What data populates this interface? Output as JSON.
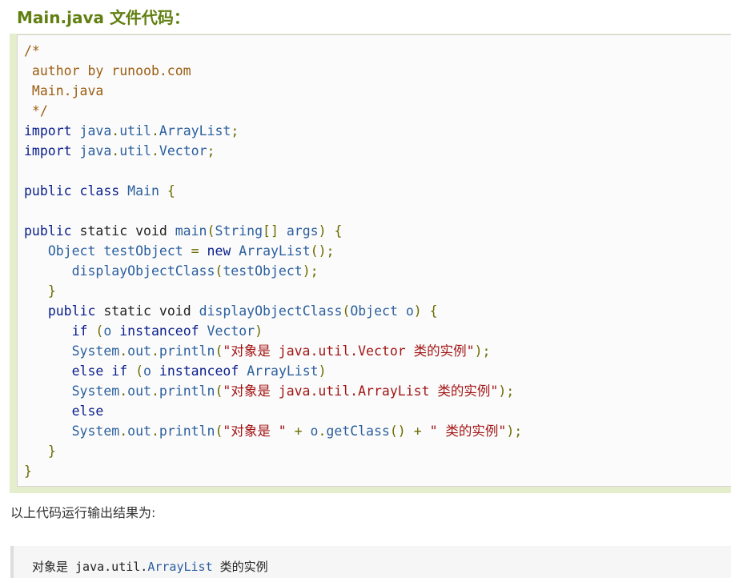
{
  "heading": "Main.java 文件代码：",
  "code_lines": [
    [
      {
        "c": "c",
        "t": "/*"
      }
    ],
    [
      {
        "c": "c",
        "t": " author by runoob.com"
      }
    ],
    [
      {
        "c": "c",
        "t": " Main.java"
      }
    ],
    [
      {
        "c": "c",
        "t": " */"
      }
    ],
    [
      {
        "c": "k",
        "t": "import"
      },
      {
        "c": "n",
        "t": " "
      },
      {
        "c": "t",
        "t": "java"
      },
      {
        "c": "p",
        "t": "."
      },
      {
        "c": "t",
        "t": "util"
      },
      {
        "c": "p",
        "t": "."
      },
      {
        "c": "t",
        "t": "ArrayList"
      },
      {
        "c": "p",
        "t": ";"
      }
    ],
    [
      {
        "c": "k",
        "t": "import"
      },
      {
        "c": "n",
        "t": " "
      },
      {
        "c": "t",
        "t": "java"
      },
      {
        "c": "p",
        "t": "."
      },
      {
        "c": "t",
        "t": "util"
      },
      {
        "c": "p",
        "t": "."
      },
      {
        "c": "t",
        "t": "Vector"
      },
      {
        "c": "p",
        "t": ";"
      }
    ],
    [],
    [
      {
        "c": "k",
        "t": "public"
      },
      {
        "c": "n",
        "t": " "
      },
      {
        "c": "k",
        "t": "class"
      },
      {
        "c": "n",
        "t": " "
      },
      {
        "c": "t",
        "t": "Main"
      },
      {
        "c": "n",
        "t": " "
      },
      {
        "c": "p",
        "t": "{"
      }
    ],
    [],
    [
      {
        "c": "k",
        "t": "public"
      },
      {
        "c": "n",
        "t": " static void "
      },
      {
        "c": "t",
        "t": "main"
      },
      {
        "c": "p",
        "t": "("
      },
      {
        "c": "t",
        "t": "String"
      },
      {
        "c": "p",
        "t": "[]"
      },
      {
        "c": "n",
        "t": " "
      },
      {
        "c": "t",
        "t": "args"
      },
      {
        "c": "p",
        "t": ")"
      },
      {
        "c": "n",
        "t": " "
      },
      {
        "c": "p",
        "t": "{"
      }
    ],
    [
      {
        "c": "n",
        "t": "   "
      },
      {
        "c": "t",
        "t": "Object"
      },
      {
        "c": "n",
        "t": " "
      },
      {
        "c": "t",
        "t": "testObject"
      },
      {
        "c": "n",
        "t": " "
      },
      {
        "c": "p",
        "t": "="
      },
      {
        "c": "n",
        "t": " "
      },
      {
        "c": "k",
        "t": "new"
      },
      {
        "c": "n",
        "t": " "
      },
      {
        "c": "t",
        "t": "ArrayList"
      },
      {
        "c": "p",
        "t": "();"
      }
    ],
    [
      {
        "c": "n",
        "t": "      "
      },
      {
        "c": "t",
        "t": "displayObjectClass"
      },
      {
        "c": "p",
        "t": "("
      },
      {
        "c": "t",
        "t": "testObject"
      },
      {
        "c": "p",
        "t": ");"
      }
    ],
    [
      {
        "c": "n",
        "t": "   "
      },
      {
        "c": "p",
        "t": "}"
      }
    ],
    [
      {
        "c": "n",
        "t": "   "
      },
      {
        "c": "k",
        "t": "public"
      },
      {
        "c": "n",
        "t": " static void "
      },
      {
        "c": "t",
        "t": "displayObjectClass"
      },
      {
        "c": "p",
        "t": "("
      },
      {
        "c": "t",
        "t": "Object"
      },
      {
        "c": "n",
        "t": " "
      },
      {
        "c": "t",
        "t": "o"
      },
      {
        "c": "p",
        "t": ")"
      },
      {
        "c": "n",
        "t": " "
      },
      {
        "c": "p",
        "t": "{"
      }
    ],
    [
      {
        "c": "n",
        "t": "      "
      },
      {
        "c": "k",
        "t": "if"
      },
      {
        "c": "n",
        "t": " "
      },
      {
        "c": "p",
        "t": "("
      },
      {
        "c": "t",
        "t": "o"
      },
      {
        "c": "n",
        "t": " "
      },
      {
        "c": "k",
        "t": "instanceof"
      },
      {
        "c": "n",
        "t": " "
      },
      {
        "c": "t",
        "t": "Vector"
      },
      {
        "c": "p",
        "t": ")"
      }
    ],
    [
      {
        "c": "n",
        "t": "      "
      },
      {
        "c": "t",
        "t": "System"
      },
      {
        "c": "p",
        "t": "."
      },
      {
        "c": "t",
        "t": "out"
      },
      {
        "c": "p",
        "t": "."
      },
      {
        "c": "t",
        "t": "println"
      },
      {
        "c": "p",
        "t": "("
      },
      {
        "c": "s",
        "t": "\"对象是 java.util.Vector 类的实例\""
      },
      {
        "c": "p",
        "t": ");"
      }
    ],
    [
      {
        "c": "n",
        "t": "      "
      },
      {
        "c": "k",
        "t": "else"
      },
      {
        "c": "n",
        "t": " "
      },
      {
        "c": "k",
        "t": "if"
      },
      {
        "c": "n",
        "t": " "
      },
      {
        "c": "p",
        "t": "("
      },
      {
        "c": "t",
        "t": "o"
      },
      {
        "c": "n",
        "t": " "
      },
      {
        "c": "k",
        "t": "instanceof"
      },
      {
        "c": "n",
        "t": " "
      },
      {
        "c": "t",
        "t": "ArrayList"
      },
      {
        "c": "p",
        "t": ")"
      }
    ],
    [
      {
        "c": "n",
        "t": "      "
      },
      {
        "c": "t",
        "t": "System"
      },
      {
        "c": "p",
        "t": "."
      },
      {
        "c": "t",
        "t": "out"
      },
      {
        "c": "p",
        "t": "."
      },
      {
        "c": "t",
        "t": "println"
      },
      {
        "c": "p",
        "t": "("
      },
      {
        "c": "s",
        "t": "\"对象是 java.util.ArrayList 类的实例\""
      },
      {
        "c": "p",
        "t": ");"
      }
    ],
    [
      {
        "c": "n",
        "t": "      "
      },
      {
        "c": "k",
        "t": "else"
      }
    ],
    [
      {
        "c": "n",
        "t": "      "
      },
      {
        "c": "t",
        "t": "System"
      },
      {
        "c": "p",
        "t": "."
      },
      {
        "c": "t",
        "t": "out"
      },
      {
        "c": "p",
        "t": "."
      },
      {
        "c": "t",
        "t": "println"
      },
      {
        "c": "p",
        "t": "("
      },
      {
        "c": "s",
        "t": "\"对象是 \""
      },
      {
        "c": "n",
        "t": " "
      },
      {
        "c": "p",
        "t": "+"
      },
      {
        "c": "n",
        "t": " "
      },
      {
        "c": "t",
        "t": "o"
      },
      {
        "c": "p",
        "t": "."
      },
      {
        "c": "t",
        "t": "getClass"
      },
      {
        "c": "p",
        "t": "()"
      },
      {
        "c": "n",
        "t": " "
      },
      {
        "c": "p",
        "t": "+"
      },
      {
        "c": "n",
        "t": " "
      },
      {
        "c": "s",
        "t": "\" 类的实例\""
      },
      {
        "c": "p",
        "t": ");"
      }
    ],
    [
      {
        "c": "n",
        "t": "   "
      },
      {
        "c": "p",
        "t": "}"
      }
    ],
    [
      {
        "c": "p",
        "t": "}"
      }
    ]
  ],
  "intro_text": "以上代码运行输出结果为:",
  "output": {
    "prefix": "对象是 java.util.",
    "class_name": "ArrayList",
    "suffix": " 类的实例"
  },
  "colors": {
    "heading": "#617f10",
    "example_bg": "#e5eecc",
    "code_bg": "#fbfbfb",
    "keyword": "#0a1e8c",
    "identifier": "#2b5f9e",
    "comment": "#9c5d12",
    "punctuation": "#6b6b00",
    "string": "#a31515"
  }
}
